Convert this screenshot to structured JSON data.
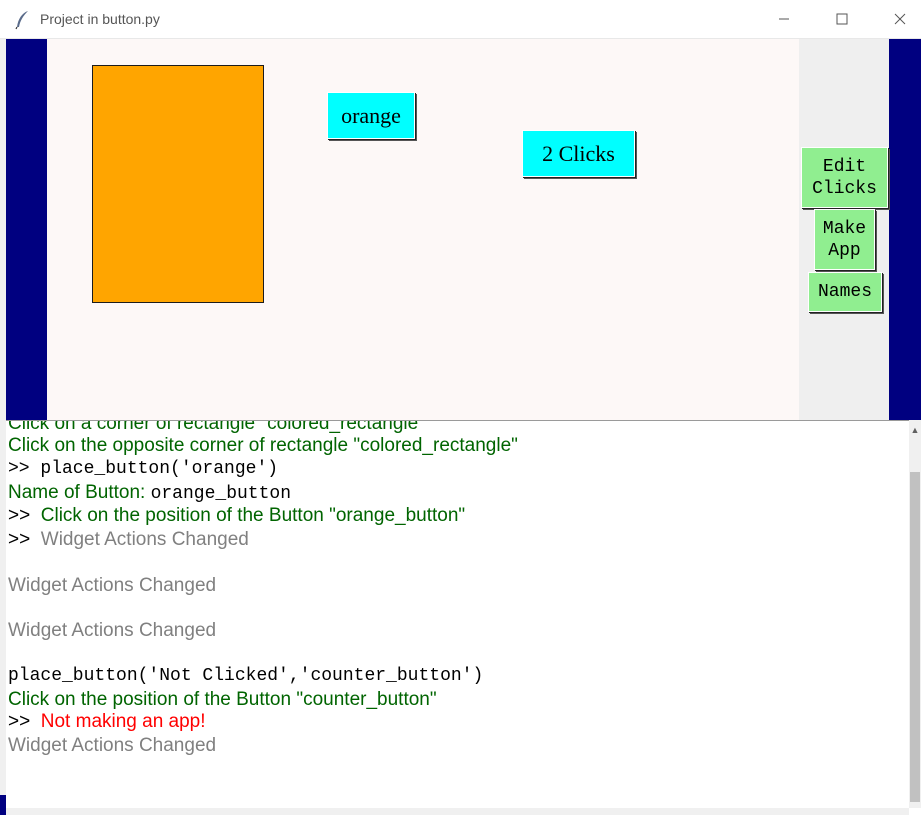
{
  "window": {
    "title": "Project in button.py",
    "icon": "feather-icon"
  },
  "canvas": {
    "rectangle_color": "#ffa500",
    "background": "#fdf8f7",
    "frame_color": "#000080",
    "orange_button_label": "orange",
    "counter_button_label": "2 Clicks"
  },
  "side_panel": {
    "edit_clicks_line1": "Edit",
    "edit_clicks_line2": "Clicks",
    "make_app_line1": "Make",
    "make_app_line2": "App",
    "names_label": "Names"
  },
  "console": {
    "lines": [
      "Click on a corner of rectangle \"colored_rectangle\"",
      "Click on the opposite corner of rectangle \"colored_rectangle\"",
      ">> place_button('orange')",
      "Name of Button: ",
      "orange_button",
      ">>",
      "Click on the position of the Button \"orange_button\"",
      ">>",
      "Widget Actions Changed",
      "Widget Actions Changed",
      "Widget Actions Changed",
      "place_button('Not Clicked','counter_button')",
      "Click on the position of the Button \"counter_button\"",
      ">>",
      "Not making an app!",
      "Widget Actions Changed"
    ]
  }
}
